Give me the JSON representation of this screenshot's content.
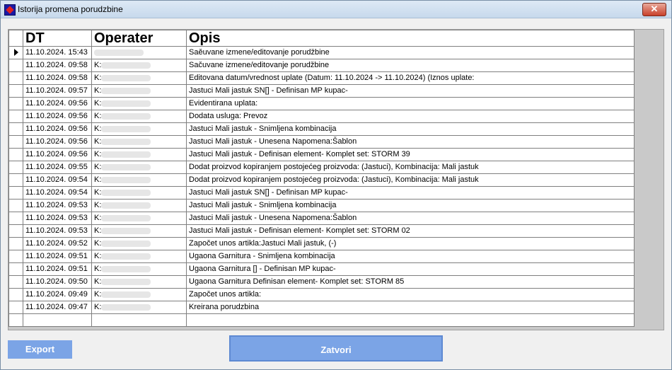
{
  "window": {
    "title": "Istorija promena porudzbine",
    "close_label": "✕"
  },
  "grid": {
    "columns": [
      "DT",
      "Operater",
      "Opis"
    ],
    "rows": [
      {
        "dt": "11.10.2024.  15:43",
        "operater": "",
        "opis": "Saěuvane izmene/editovanje porudžbine",
        "selected": true
      },
      {
        "dt": "11.10.2024.  09:58",
        "operater": "K:",
        "opis": "Sačuvane izmene/editovanje porudžbine"
      },
      {
        "dt": "11.10.2024.  09:58",
        "operater": "K:",
        "opis": "Editovana datum/vrednost uplate (Datum: 11.10.2024 -> 11.10.2024) (Iznos uplate:"
      },
      {
        "dt": "11.10.2024.  09:57",
        "operater": "K:",
        "opis": "Jastuci Mali jastuk  SN[] - Definisan MP kupac-"
      },
      {
        "dt": "11.10.2024.  09:56",
        "operater": "K:",
        "opis": "Evidentirana uplata:"
      },
      {
        "dt": "11.10.2024.  09:56",
        "operater": "K:",
        "opis": "Dodata usluga: Prevoz"
      },
      {
        "dt": "11.10.2024.  09:56",
        "operater": "K:",
        "opis": "Jastuci Mali jastuk - Snimljena kombinacija"
      },
      {
        "dt": "11.10.2024.  09:56",
        "operater": "K:",
        "opis": "Jastuci Mali jastuk - Unesena Napomena:Šablon"
      },
      {
        "dt": "11.10.2024.  09:56",
        "operater": "K:",
        "opis": "Jastuci Mali jastuk - Definisan element- Komplet set: STORM 39"
      },
      {
        "dt": "11.10.2024.  09:55",
        "operater": "K:",
        "opis": "Dodat proizvod kopiranjem postojećeg proizvoda:   (Jastuci), Kombinacija: Mali jastuk"
      },
      {
        "dt": "11.10.2024.  09:54",
        "operater": "K:",
        "opis": "Dodat proizvod kopiranjem postojećeg proizvoda:   (Jastuci), Kombinacija: Mali jastuk"
      },
      {
        "dt": "11.10.2024.  09:54",
        "operater": "K:",
        "opis": "Jastuci Mali jastuk  SN[] - Definisan MP kupac-"
      },
      {
        "dt": "11.10.2024.  09:53",
        "operater": "K:",
        "opis": "Jastuci Mali jastuk - Snimljena kombinacija"
      },
      {
        "dt": "11.10.2024.  09:53",
        "operater": "K:",
        "opis": "Jastuci Mali jastuk - Unesena Napomena:Šablon"
      },
      {
        "dt": "11.10.2024.  09:53",
        "operater": "K:",
        "opis": "Jastuci Mali jastuk - Definisan element- Komplet set: STORM 02"
      },
      {
        "dt": "11.10.2024.  09:52",
        "operater": "K:",
        "opis": "Započet unos artikla:Jastuci Mali jastuk, (-)"
      },
      {
        "dt": "11.10.2024.  09:51",
        "operater": "K:",
        "opis": "Ugaona Garnitura  - Snimljena kombinacija"
      },
      {
        "dt": "11.10.2024.  09:51",
        "operater": "K:",
        "opis": "Ugaona Garnitura  [] - Definisan MP kupac-"
      },
      {
        "dt": "11.10.2024.  09:50",
        "operater": "K:",
        "opis": "Ugaona Garnitura  Definisan element- Komplet set: STORM 85"
      },
      {
        "dt": "11.10.2024.  09:49",
        "operater": "K:",
        "opis": "Započet unos artikla:"
      },
      {
        "dt": "11.10.2024.  09:47",
        "operater": "K:",
        "opis": "Kreirana porudzbina"
      }
    ]
  },
  "buttons": {
    "export_label": "Export",
    "close_label": "Zatvori"
  },
  "colors": {
    "button_blue": "#7ba4e6",
    "panel_gray": "#c9c9c9"
  }
}
